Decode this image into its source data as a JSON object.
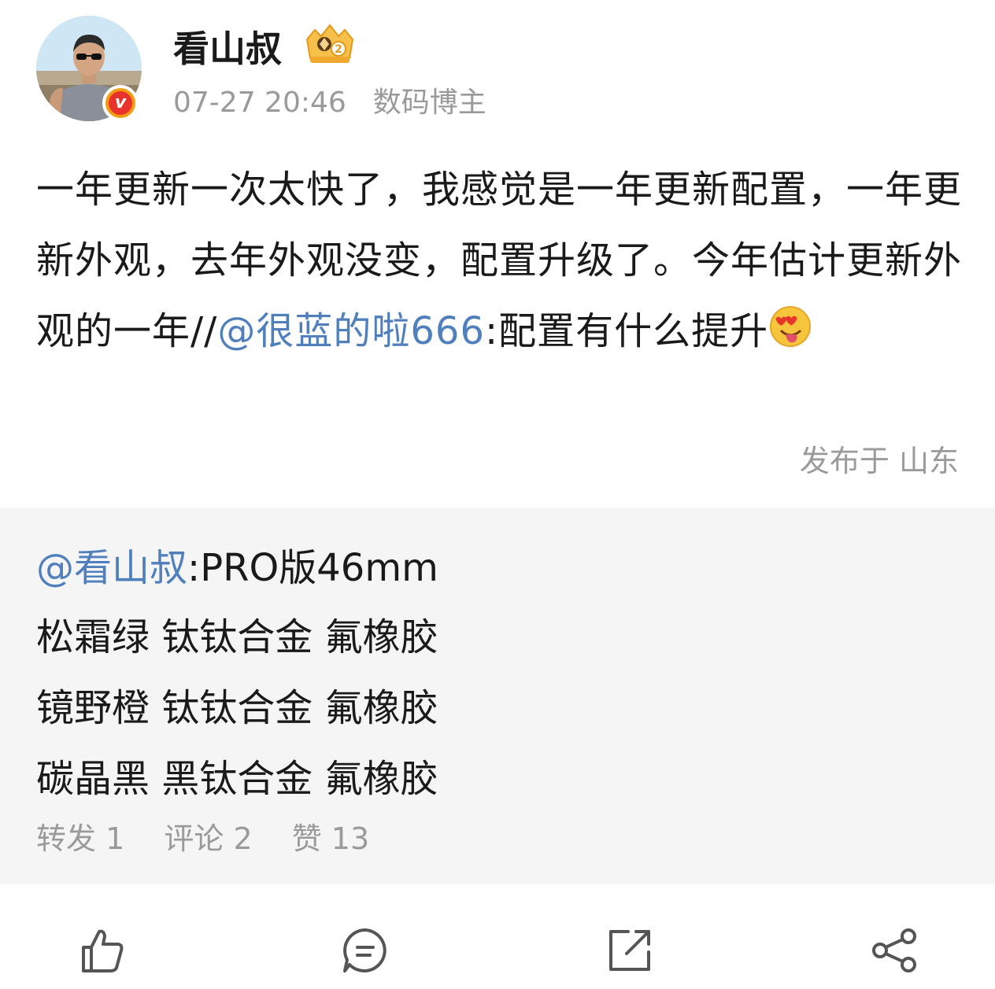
{
  "post": {
    "author": "看山叔",
    "timestamp": "07-27 20:46",
    "author_tag": "数码博主",
    "text_part1": "一年更新一次太快了，我感觉是一年更新配置，一年更新外观，去年外观没变，配置升级了。今年估计更新外观的一年//",
    "mention": "@很蓝的啦666",
    "text_part2": ":配置有什么提升",
    "emoji": "heart-eyes-tongue-emoji",
    "location": "发布于 山东"
  },
  "quoted": {
    "mention": "@看山叔",
    "line1_rest": ":PRO版46mm",
    "line2": "松霜绿 钛钛合金 氟橡胶",
    "line3": "镜野橙 钛钛合金 氟橡胶",
    "line4": "碳晶黑 黑钛合金 氟橡胶",
    "stats": {
      "repost": "转发 1",
      "comment": "评论 2",
      "like": "赞 13"
    }
  },
  "actions": [
    "like-icon",
    "comment-icon",
    "repost-icon",
    "share-icon"
  ],
  "colors": {
    "mention": "#4f7fbd",
    "secondary_text": "#9a9a9a",
    "quote_bg": "#f5f5f5"
  }
}
